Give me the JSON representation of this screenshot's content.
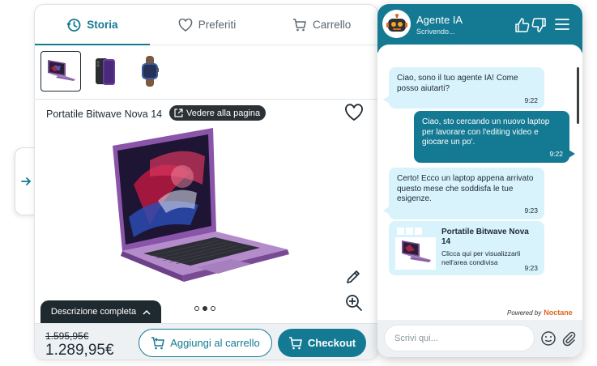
{
  "tabs": [
    {
      "label": "Storia",
      "icon": "history-icon",
      "active": true
    },
    {
      "label": "Preferiti",
      "icon": "heart-outline-icon",
      "active": false
    },
    {
      "label": "Carrello",
      "icon": "cart-icon",
      "active": false
    }
  ],
  "thumbnails": [
    "laptop-purple-thumbnail",
    "smartphone-purple-thumbnail",
    "smartwatch-purple-thumbnail"
  ],
  "product": {
    "title": "Portatile Bitwave Nova 14",
    "see_page_label": "Vedere alla pagina",
    "description_label": "Descrizione completa",
    "old_price": "1.595,95€",
    "new_price": "1.289,95€",
    "add_to_cart_label": "Aggiungi al carrello",
    "checkout_label": "Checkout",
    "carousel_active_index": 1,
    "carousel_count": 3
  },
  "chat": {
    "agent_name": "Agente IA",
    "agent_status": "Scrivendo...",
    "messages": [
      {
        "from": "bot",
        "text": "Ciao, sono il tuo agente IA! Come posso aiutarti?",
        "time": "9:22"
      },
      {
        "from": "user",
        "text": "Ciao, sto cercando un nuovo laptop per lavorare con l'editing video e giocare un po'.",
        "time": "9:22"
      },
      {
        "from": "bot",
        "text": "Certo! Ecco un laptop appena arrivato questo mese che soddisfa le tue esigenze.",
        "time": "9:23"
      }
    ],
    "card": {
      "title": "Portatile Bitwave Nova 14",
      "subtitle": "Clicca qui per visualizzarli nell'area condivisa",
      "time": "9:23"
    },
    "powered_by": "Powered by",
    "brand": "Noctane",
    "input_placeholder": "Scrivi qui..."
  },
  "colors": {
    "accent": "#147a93",
    "dark": "#1f2a30",
    "bot_bubble": "#d8f3fb",
    "brand": "#e0641f"
  }
}
